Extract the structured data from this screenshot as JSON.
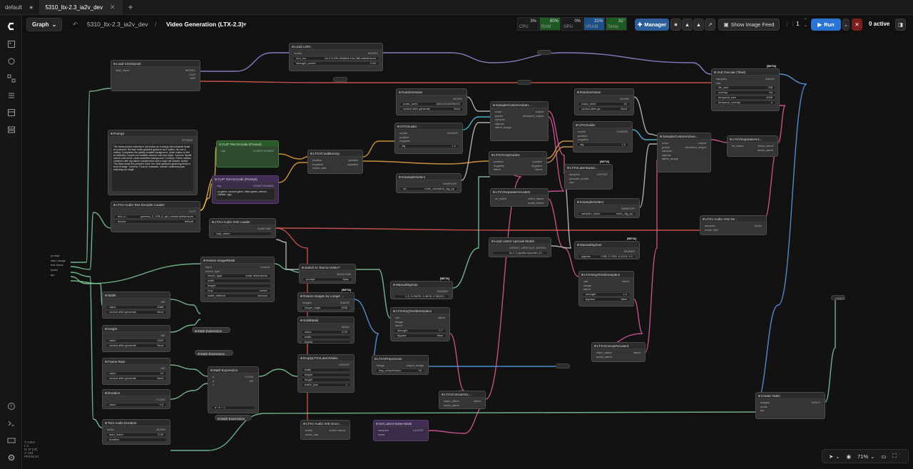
{
  "tabs": [
    {
      "label": "default",
      "active": false
    },
    {
      "label": "5310_ltx-2.3_ia2v_dev",
      "active": true
    }
  ],
  "toolbar": {
    "graph_label": "Graph",
    "workflow_name": "5310_ltx-2.3_ia2v_dev",
    "separator": "/",
    "subgraph_name": "Video Generation (LTX-2.3)",
    "stats": [
      {
        "name": "CPU",
        "value": "3%"
      },
      {
        "name": "RAM",
        "value": "80%"
      },
      {
        "name": "GPU",
        "value": "0%"
      },
      {
        "name": "VRAM",
        "value": "31%"
      },
      {
        "name": "Temp",
        "value": "31°"
      }
    ],
    "manager_label": "Manager",
    "image_feed_label": "Show Image Feed",
    "queue_count": "1",
    "run_label": "Run",
    "active_label": "0 active"
  },
  "nodes": {
    "load_checkpoint": {
      "title": "Load Checkpoint",
      "outputs": [
        "MODEL",
        "CLIP",
        "VAE"
      ],
      "input": "ckpt_name"
    },
    "load_lora": {
      "title": "Load LoRA",
      "inputs": [
        "model"
      ],
      "outputs": [
        "MODEL"
      ],
      "w1": "lora_na...",
      "w1v": "ltx-2.3-22b-distilled-lora-384.safetensors",
      "w2": "strength_model",
      "w2v": "0.60"
    },
    "prompt": {
      "title": "Prompt",
      "output": "STRING",
      "text": "The frame pulses violently in full motion as it swings the industrial beast at a camera. His face hosts graceful gestures as it smiles, his cue is setting. Completes the quietly scripted background. Quiet makes to feel as dramatic, impact non-realistic camera rush and stops.\n\nCamera: Spotlit scenic road scrub, clean seamless background. Conveys: Scene various creatures with leg nature complexions and a major old statues.\n\nAction: The head stride the peaceful mark, the other gestures gesturing firmly in front of stage.\nCamera: Front on character, smooth continuous pan watching our stage"
    },
    "clip_text_pos": {
      "title": "CLIP Text Encode (Prompt)",
      "input": "clip",
      "output": "CONDITIONING"
    },
    "clip_text_neg": {
      "title": "CLIP Text Encode (Prompt)",
      "input": "clip",
      "output": "CONDITIONING",
      "text": "pc game, console game, video game, cartoon, childish, ugly"
    },
    "ltxv_conditioning": {
      "title": "LTXVConditioning",
      "inputs": [
        "positive",
        "negative",
        "frame_rate"
      ],
      "outputs": [
        "positive",
        "negative"
      ]
    },
    "ltxv_audio_text": {
      "title": "LTXV Audio Text Encoder Loader",
      "output": "CLIP",
      "w1": "text_e...",
      "w1v": "gemma_3_12B_it_fp4_mixed.safetensors",
      "w2": "device",
      "w2v": "default"
    },
    "ltxv_audio_vae": {
      "title": "LTXV Audio VAE Loader",
      "output": "Audio VAE",
      "w1": "ckpt_name"
    },
    "random_noise_1": {
      "title": "RandomNoise",
      "output": "NOISE",
      "w1": "noise_seed",
      "w1v": "660426158096024",
      "w2": "control after generate",
      "w2v": "fixed"
    },
    "cfg_guider_1": {
      "title": "CFGGuider",
      "inputs": [
        "model",
        "positive",
        "negative"
      ],
      "output": "GUIDER",
      "w1": "cfg",
      "w1v": "1.0"
    },
    "ksampler_select_1": {
      "title": "KSamplerSelect",
      "output": "SAMPLER",
      "w1": "sa...",
      "w1v": "euler_ancestral_cfg_pp"
    },
    "sampler_custom_1": {
      "title": "SamplerCustomAdvan...",
      "inputs": [
        "noise",
        "guider",
        "sampler",
        "sigmas",
        "latent_image"
      ],
      "outputs": [
        "output",
        "denoised_output"
      ]
    },
    "ltxv_crop_guides": {
      "title": "LTXVCropGuides",
      "inputs": [
        "positive",
        "negative",
        "latent"
      ],
      "outputs": [
        "positive",
        "negative",
        "latent"
      ]
    },
    "ltxv_separate_1": {
      "title": "LTXVSeparateAVLatent",
      "input": "av_latent",
      "outputs": [
        "video_latent",
        "audio_latent"
      ]
    },
    "random_noise_2": {
      "title": "RandomNoise",
      "output": "NOISE",
      "w1": "noise_seed",
      "w1v": "42",
      "w2": "control after ge...",
      "w2v": "fixed"
    },
    "cfg_guider_2": {
      "title": "CFGGuider",
      "inputs": [
        "model",
        "positive",
        "negative"
      ],
      "output": "GUIDER",
      "w1": "cfg",
      "w1v": "1.0"
    },
    "ltxv_latent_upsampler": {
      "title": "LTXVLatentUpsa...",
      "inputs": [
        "samples",
        "upscale_model",
        "vae"
      ],
      "output": "LATENT",
      "beta": "[BETA]"
    },
    "ksampler_select_2": {
      "title": "KSamplerSelect",
      "output": "SAMPLER",
      "w1": "sampler_name",
      "w1v": "euler_cfg_pp"
    },
    "sampler_custom_2": {
      "title": "SamplerCustomAdvan...",
      "inputs": [
        "noise",
        "guider",
        "sampler",
        "sigmas",
        "latent_image"
      ],
      "outputs": [
        "output",
        "denoised_output"
      ]
    },
    "ltxv_separate_2": {
      "title": "LTXVSeparateAVL...",
      "input": "av_latent",
      "outputs": [
        "video_latent",
        "audio_latent"
      ]
    },
    "vae_decode_tiled": {
      "title": "VAE Decode (Tiled)",
      "beta": "[BETA]",
      "inputs": [
        "samples",
        "vae"
      ],
      "output": "IMAGE",
      "widgets": [
        [
          "tile_size",
          "768"
        ],
        [
          "overlap",
          "64"
        ],
        [
          "temporal_size",
          "4096"
        ],
        [
          "temporal_overlap",
          "4"
        ]
      ]
    },
    "ltxv_audio_vae_decode": {
      "title": "LTXV Audio VAE De...",
      "inputs": [
        "samples",
        "Audio VAE"
      ],
      "output": "Audio"
    },
    "load_latent_upscale": {
      "title": "Load Latent Upscale Model",
      "output": "LATENT_UPSCALE_MODEL",
      "w1v": "ltx-2.3-spatial-upscaler-x2..."
    },
    "manual_sigmas_1": {
      "title": "ManualSigmas",
      "beta": "[BETA]",
      "output": "SIGMAS",
      "w1": "sigmas",
      "w1v": "0.85, 0.7250, 0.4219, 0.0"
    },
    "ltxv_img_to_video_2": {
      "title": "LTXVImgToVideoInplace",
      "inputs": [
        "vae",
        "image",
        "latent"
      ],
      "output": "latent",
      "w1": "strength",
      "w1v": "1.0",
      "w2": "bypass",
      "w2v": "false"
    },
    "ltxv_concat_1": {
      "title": "LTXVConcatAVLatent",
      "inputs": [
        "video_latent",
        "audio_latent"
      ],
      "output": "latent"
    },
    "resize_image_mask": {
      "title": "Resize Image/Mask",
      "inputs": [
        "input",
        "resize_type"
      ],
      "output": "resized",
      "w1": "resize_type",
      "w1v": "scale dimensions",
      "w2": "width",
      "w3": "height",
      "w4": "crop",
      "w4v": "center",
      "w5": "scale_method",
      "w5v": "lanczos"
    },
    "switch_text_video": {
      "title": "Switch to Text-to-Video?",
      "output": "BOOLEAN",
      "w1": "prompt",
      "w1v": "false"
    },
    "manual_sigmas_2": {
      "title": "ManualSigmas",
      "beta": "[BETA]",
      "output": "SIGMAS",
      "w1v": "1.0, 0.99375, 0.9875, 0.98125..."
    },
    "resize_longer": {
      "title": "Resize Images by Longer ...",
      "beta": "[BETA]",
      "input": "images",
      "output": "IMAGE",
      "w1": "longer_edge",
      "w1v": "1536"
    },
    "ltxv_img_to_video_1": {
      "title": "LTXVImgToVideoInplace",
      "inputs": [
        "vae",
        "image",
        "latent"
      ],
      "output": "latent",
      "w1": "strength",
      "w1v": "0.7",
      "w2": "bypass",
      "w2v": "false"
    },
    "solid_mask": {
      "title": "SolidMask",
      "output": "MASK",
      "w1": "value",
      "w1v": "0.00",
      "w2": "width",
      "w3": "height"
    },
    "empty_ltxv_latent": {
      "title": "EmptyLTXVLatentVideo",
      "output": "LATENT",
      "w1": "width",
      "w2": "height",
      "w3": "length",
      "w4": "batch_size",
      "w4v": "1"
    },
    "ltxv_preprocess": {
      "title": "LTXVPreprocess",
      "input": "image",
      "output": "output_image",
      "w1": "img_compression",
      "w1v": "18"
    },
    "ltxv_concat_2": {
      "title": "LTXVConcatAVL...",
      "inputs": [
        "video_latent",
        "audio_latent"
      ],
      "output": "latent"
    },
    "width": {
      "title": "Width",
      "output": "INT",
      "w1": "value",
      "w1v": "1088",
      "w2": "control after generate",
      "w2v": "fixed"
    },
    "height": {
      "title": "Height",
      "output": "INT",
      "w1": "value",
      "w1v": "1920",
      "w2": "control after generate",
      "w2v": "fixed"
    },
    "frame_rate": {
      "title": "Frame Rate",
      "output": "INT",
      "w1": "value",
      "w1v": "24",
      "w2": "control after generate",
      "w2v": "fixed"
    },
    "duration": {
      "title": "Duration",
      "output": "FLOAT",
      "w1": "value",
      "w1v": "5.0"
    },
    "trim_audio": {
      "title": "Trim Audio Duration",
      "input": "audio",
      "output": "AUDIO",
      "w1": "start_index",
      "w1v": "0.00",
      "w2": "duration"
    },
    "math_expr_main": {
      "title": "Math Expression",
      "inputs": [
        "a",
        "b",
        "c"
      ],
      "outputs": [
        "FLOAT",
        "INT"
      ],
      "expr": "a * b + 1"
    },
    "math_expr_a": {
      "title": "Math Expression"
    },
    "math_expr_b": {
      "title": "Math Expression"
    },
    "math_expr_c": {
      "title": "Math Expression"
    },
    "ltxv_audio_vae_encode": {
      "title": "LTXV Audio VAE Enco...",
      "inputs": [
        "audio",
        "audio_vae"
      ],
      "output": "Audio Latent"
    },
    "set_latent_noise_mask": {
      "title": "Set Latent Noise Mask",
      "inputs": [
        "samples",
        "mask"
      ],
      "output": "LATENT"
    },
    "create_video": {
      "title": "Create Video",
      "inputs": [
        "images",
        "audio",
        "fps"
      ],
      "output": "VIDEO"
    }
  },
  "group_inputs": [
    "prompt",
    "start_image",
    "first frame",
    "audio",
    "fps"
  ],
  "group_output": "VIDEO",
  "status_lines": [
    "T: 0.00s",
    "I: 0",
    "N: 37 [37]",
    "V: 133",
    "FPS:60.24"
  ],
  "zoom_label": "71%"
}
